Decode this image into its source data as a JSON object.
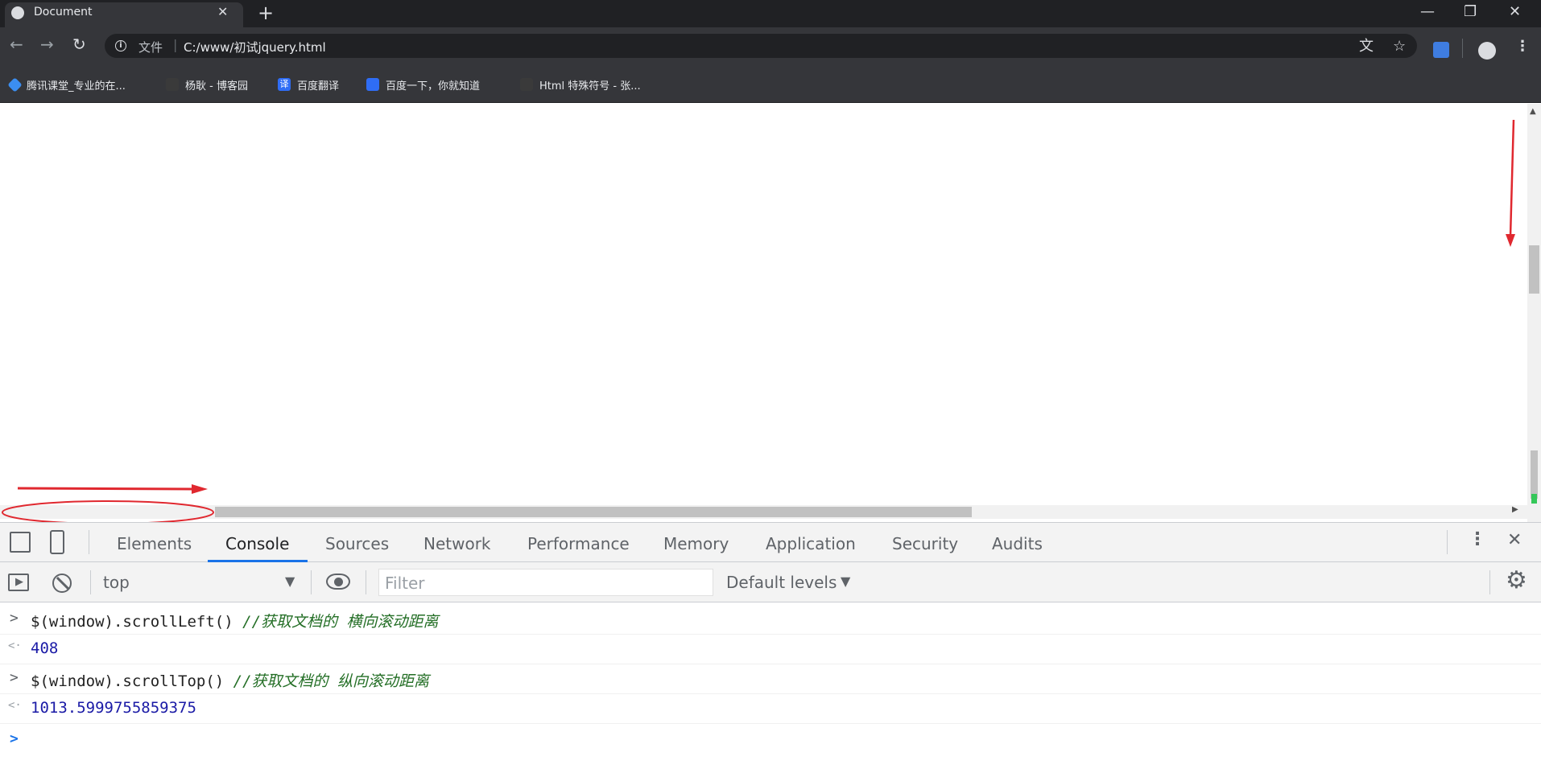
{
  "browser": {
    "tab_title": "Document",
    "tab_close": "✕",
    "new_tab": "+",
    "window": {
      "minimize": "—",
      "restore": "❐",
      "close": "✕"
    },
    "url_prefix": "文件",
    "url_separator": "|",
    "url": "C:/www/初试jquery.html"
  },
  "bookmarks": [
    {
      "label": "腾讯课堂_专业的在...",
      "icon_color": "#3b8ef0"
    },
    {
      "label": "杨耿 - 博客园",
      "icon_color": "#3a3a3a"
    },
    {
      "label": "百度翻译",
      "icon_color": "#2f6df5"
    },
    {
      "label": "百度一下，你就知道",
      "icon_color": "#2f6df5"
    },
    {
      "label": "Html 特殊符号 - 张...",
      "icon_color": "#3a3a3a"
    }
  ],
  "devtools": {
    "tabs": [
      "Elements",
      "Console",
      "Sources",
      "Network",
      "Performance",
      "Memory",
      "Application",
      "Security",
      "Audits"
    ],
    "active_tab": "Console",
    "context": "top",
    "filter_placeholder": "Filter",
    "levels": "Default levels",
    "console": [
      {
        "kind": "input",
        "code": "$(window).scrollLeft()",
        "comment": "//获取文档的 横向滚动距离"
      },
      {
        "kind": "output",
        "value": "408"
      },
      {
        "kind": "input",
        "code": "$(window).scrollTop()",
        "comment": "//获取文档的 纵向滚动距离"
      },
      {
        "kind": "output",
        "value": "1013.5999755859375"
      }
    ]
  },
  "colors": {
    "annotation_red": "#e0282f",
    "accent_blue": "#1a73e8"
  }
}
